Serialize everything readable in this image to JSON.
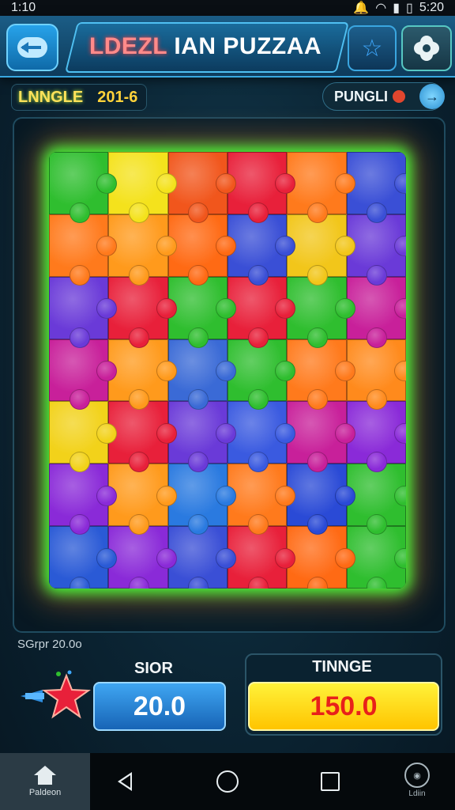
{
  "status_bar": {
    "time": "1:10",
    "clock_right": "5:20",
    "icons": [
      "notification-icon",
      "wifi-icon",
      "signal-icon",
      "battery-icon"
    ]
  },
  "header": {
    "title_part1": "LDEZL",
    "title_part2": "IAN PUZZAA",
    "back_icon": "back-arrow-icon",
    "favorite_icon": "star-icon",
    "settings_icon": "gear-icon"
  },
  "level": {
    "label": "LNNGLE",
    "value": "201-6"
  },
  "hint": {
    "label": "PUNGLI",
    "icon": "arrow-right-icon"
  },
  "board": {
    "rows": 7,
    "cols": 6,
    "pieces": [
      "#2fbe2f",
      "#f4e21c",
      "#f1561c",
      "#e8203a",
      "#ff7a1c",
      "#3a4fd6",
      "#ff7a1c",
      "#ff9a1c",
      "#ff6a14",
      "#3a4fd6",
      "#f2c61a",
      "#6a3ad8",
      "#6a3ad8",
      "#e8203a",
      "#2fbe2f",
      "#e8203a",
      "#2fbe2f",
      "#c8209a",
      "#c8209a",
      "#ff9a1c",
      "#3a6ad6",
      "#2fbe2f",
      "#ff7a1c",
      "#ff8a1c",
      "#f2d21a",
      "#e8203a",
      "#6a3ad8",
      "#3a5ae0",
      "#c8209a",
      "#8a2ad8",
      "#8a2ad8",
      "#ff9a1c",
      "#2a7ae0",
      "#ff7a1c",
      "#2a4ad6",
      "#2fbe2f",
      "#2a5ad6",
      "#8a2ad8",
      "#3a4fd6",
      "#e8203a",
      "#ff6a14",
      "#2fbe2f"
    ]
  },
  "score": {
    "sub_label": "SGrpr 20.0o",
    "title": "SIOR",
    "value": "20.0"
  },
  "time": {
    "title": "TINNGE",
    "value": "150.0"
  },
  "nav": {
    "home_label": "Paldeon",
    "profile_label": "Ldiin"
  },
  "colors": {
    "accent": "#38a7e0",
    "board_glow": "#42ff3a",
    "score_blue": "#1764b6",
    "time_yellow": "#ffc400"
  }
}
